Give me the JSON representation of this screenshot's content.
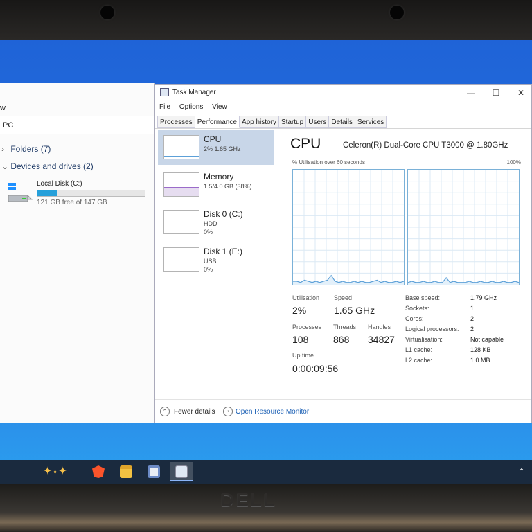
{
  "explorer": {
    "menu_fragment": "w",
    "address_fragment": "PC",
    "folders_label": "Folders (7)",
    "devices_label": "Devices and drives (2)",
    "drive": {
      "name": "Local Disk (C:)",
      "free_text": "121 GB free of 147 GB",
      "used_fraction": 0.18
    }
  },
  "task_manager": {
    "title": "Task Manager",
    "window_controls": {
      "minimize": "—",
      "maximize": "☐",
      "close": "✕"
    },
    "menu": [
      "File",
      "Options",
      "View"
    ],
    "tabs": [
      "Processes",
      "Performance",
      "App history",
      "Startup",
      "Users",
      "Details",
      "Services"
    ],
    "active_tab": "Performance",
    "resources": [
      {
        "name": "CPU",
        "sub1": "2% 1.65 GHz",
        "sub2": ""
      },
      {
        "name": "Memory",
        "sub1": "1.5/4.0 GB (38%)",
        "sub2": ""
      },
      {
        "name": "Disk 0 (C:)",
        "sub1": "HDD",
        "sub2": "0%"
      },
      {
        "name": "Disk 1 (E:)",
        "sub1": "USB",
        "sub2": "0%"
      }
    ],
    "cpu": {
      "heading": "CPU",
      "model": "Celeron(R) Dual-Core CPU T3000 @ 1.80GHz",
      "graph_label": "% Utilisation over 60 seconds",
      "graph_max": "100%",
      "stats": {
        "utilisation_label": "Utilisation",
        "utilisation": "2%",
        "speed_label": "Speed",
        "speed": "1.65 GHz",
        "processes_label": "Processes",
        "processes": "108",
        "threads_label": "Threads",
        "threads": "868",
        "handles_label": "Handles",
        "handles": "34827",
        "uptime_label": "Up time",
        "uptime": "0:00:09:56"
      },
      "specs": [
        {
          "k": "Base speed:",
          "v": "1.79 GHz"
        },
        {
          "k": "Sockets:",
          "v": "1"
        },
        {
          "k": "Cores:",
          "v": "2"
        },
        {
          "k": "Logical processors:",
          "v": "2"
        },
        {
          "k": "Virtualisation:",
          "v": "Not capable"
        },
        {
          "k": "L1 cache:",
          "v": "128 KB"
        },
        {
          "k": "L2 cache:",
          "v": "1.0 MB"
        }
      ],
      "core_series": [
        [
          3,
          3,
          2,
          4,
          3,
          2,
          3,
          2,
          3,
          4,
          8,
          3,
          2,
          3,
          2,
          2,
          3,
          2,
          3,
          2,
          2,
          3,
          4,
          2,
          3,
          2,
          2,
          3,
          2,
          3
        ],
        [
          2,
          3,
          2,
          2,
          3,
          2,
          2,
          3,
          2,
          2,
          6,
          2,
          3,
          2,
          2,
          2,
          3,
          2,
          2,
          3,
          2,
          2,
          3,
          2,
          2,
          3,
          2,
          2,
          3,
          2
        ]
      ]
    },
    "footer": {
      "fewer_details": "Fewer details",
      "open_resource_monitor": "Open Resource Monitor"
    }
  },
  "colors": {
    "accent": "#26a0da",
    "cpu_line": "#5ca0d8",
    "selected": "#c8d6e8",
    "link": "#1a5fb4"
  },
  "taskbar": {
    "icons": [
      "copilot-sparkle-icon",
      "brave-icon",
      "file-explorer-icon",
      "microsoft-store-icon",
      "task-manager-icon"
    ]
  },
  "bezel_logo": "DELL"
}
